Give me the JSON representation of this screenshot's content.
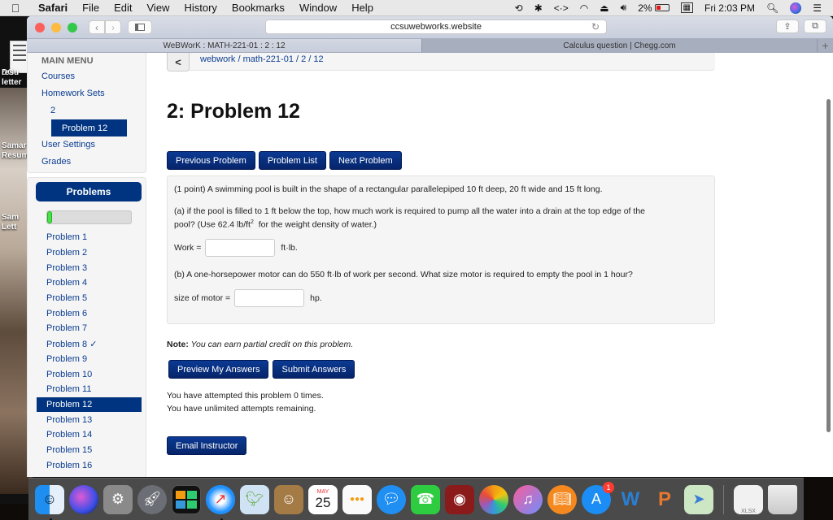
{
  "menubar": {
    "apple_icon": "apple-icon",
    "items": [
      "Safari",
      "File",
      "Edit",
      "View",
      "History",
      "Bookmarks",
      "Window",
      "Help"
    ],
    "status": {
      "battery_percent": "2%",
      "clock": "Fri 2:03 PM",
      "icons": [
        "time-machine-icon",
        "bluetooth-icon",
        "code-icon",
        "wifi-icon",
        "eject-icon",
        "volume-icon",
        "battery-icon",
        "calendar-icon",
        "spotlight-icon",
        "siri-icon",
        "notification-center-icon"
      ]
    }
  },
  "desktop": {
    "labels": [
      "resu",
      "letter",
      "Samar",
      "Resum",
      "Sam",
      "Lett"
    ],
    "doc_label": "DO"
  },
  "browser": {
    "url": "ccsuwebworks.website",
    "tabs": [
      {
        "title": "WeBWorK : MATH-221-01 : 2 : 12",
        "active": true
      },
      {
        "title": "Calculus question | Chegg.com",
        "active": false
      }
    ],
    "new_tab": "+"
  },
  "sidebar": {
    "main_menu_title": "MAIN MENU",
    "links": {
      "courses": "Courses",
      "homework_sets": "Homework Sets",
      "set": "2",
      "current_problem": "Problem 12",
      "user_settings": "User Settings",
      "grades": "Grades"
    },
    "problems_header": "Problems",
    "progress_fraction": 0.06,
    "problems": [
      {
        "label": "Problem 1",
        "active": false
      },
      {
        "label": "Problem 2",
        "active": false
      },
      {
        "label": "Problem 3",
        "active": false
      },
      {
        "label": "Problem 4",
        "active": false
      },
      {
        "label": "Problem 5",
        "active": false
      },
      {
        "label": "Problem 6",
        "active": false
      },
      {
        "label": "Problem 7",
        "active": false
      },
      {
        "label": "Problem 8 ✓",
        "active": false
      },
      {
        "label": "Problem 9",
        "active": false
      },
      {
        "label": "Problem 10",
        "active": false
      },
      {
        "label": "Problem 11",
        "active": false
      },
      {
        "label": "Problem 12",
        "active": true
      },
      {
        "label": "Problem 13",
        "active": false
      },
      {
        "label": "Problem 14",
        "active": false
      },
      {
        "label": "Problem 15",
        "active": false
      },
      {
        "label": "Problem 16",
        "active": false
      }
    ]
  },
  "main": {
    "breadcrumb": "webwork / math-221-01 / 2 / 12",
    "back_glyph": "<",
    "title": "2: Problem 12",
    "nav_buttons": {
      "previous": "Previous Problem",
      "list": "Problem List",
      "next": "Next Problem"
    },
    "problem": {
      "intro": "(1 point) A swimming pool is built in the shape of a rectangular parallelepiped 10 ft deep, 20 ft wide and 15 ft long.",
      "part_a_1": "(a) if the pool is filled to 1 ft below the top, how much work is required to pump all the water into a drain at the top edge of the",
      "part_a_2_pre": "pool? (Use 62.4 lb/ft",
      "part_a_2_sup": "2",
      "part_a_2_post": "  for the weight density of water.)",
      "work_label": "Work =",
      "work_value": "",
      "work_unit": "ft·lb.",
      "part_b": "(b) A one-horsepower motor can do 550 ft·lb of work per second. What size motor is required to empty the pool in 1 hour?",
      "motor_label": "size of motor =",
      "motor_value": "",
      "motor_unit": "hp."
    },
    "note_bold": "Note:",
    "note_italic": " You can earn partial credit on this problem.",
    "action_buttons": {
      "preview": "Preview My Answers",
      "submit": "Submit Answers"
    },
    "attempts_line1": "You have attempted this problem 0 times.",
    "attempts_line2": "You have unlimited attempts remaining.",
    "email_instructor": "Email Instructor"
  },
  "dock": {
    "calendar_month": "MAY",
    "calendar_day": "25",
    "app_store_badge": "1",
    "apps": [
      "Finder",
      "Siri",
      "System Preferences",
      "Launchpad",
      "Mission Control",
      "Safari",
      "Mail",
      "Contacts",
      "Calendar",
      "Reminders",
      "Messages",
      "FaceTime",
      "Photo Booth",
      "Photos",
      "iTunes",
      "iBooks",
      "App Store",
      "Word",
      "PowerPoint",
      "Maps",
      "XLSX Document",
      "Trash"
    ]
  }
}
